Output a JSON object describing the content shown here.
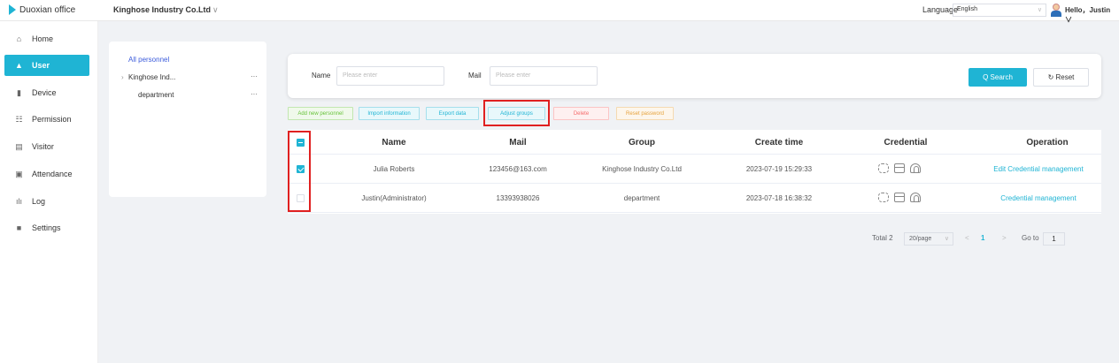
{
  "app": {
    "name": "Duoxian office",
    "company": "Kinghose Industry Co.Ltd",
    "company_chevron": "∨"
  },
  "header": {
    "language_label": "Language",
    "language_value": "English",
    "select_chevron": "∨",
    "greeting": "Hello，Justin ∨"
  },
  "sidebar": {
    "items": [
      {
        "label": "Home",
        "icon": "home-icon",
        "glyph": "⌂"
      },
      {
        "label": "User",
        "icon": "user-icon",
        "glyph": "👤"
      },
      {
        "label": "Device",
        "icon": "device-icon",
        "glyph": "▮"
      },
      {
        "label": "Permission",
        "icon": "permission-icon",
        "glyph": "☷"
      },
      {
        "label": "Visitor",
        "icon": "visitor-icon",
        "glyph": "▤"
      },
      {
        "label": "Attendance",
        "icon": "attendance-icon",
        "glyph": "▣"
      },
      {
        "label": "Log",
        "icon": "log-icon",
        "glyph": "ılı"
      },
      {
        "label": "Settings",
        "icon": "settings-icon",
        "glyph": "■"
      }
    ],
    "active": "User"
  },
  "tree": {
    "all": "All personnel",
    "nodes": [
      {
        "label": "Kinghose Ind...",
        "prefix": "›",
        "dots": "···"
      },
      {
        "label": "department",
        "dots": "···"
      }
    ]
  },
  "search": {
    "name_label": "Name",
    "name_placeholder": "Please enter",
    "mail_label": "Mail",
    "mail_placeholder": "Please enter",
    "search_button": "Q Search",
    "reset_button": "↻ Reset"
  },
  "actions": {
    "add": "Add new personnel",
    "import": "Import information",
    "export": "Export data",
    "adjust": "Adjust groups",
    "delete": "Delete",
    "reset_password": "Reset password"
  },
  "table": {
    "columns": [
      "Name",
      "Mail",
      "Group",
      "Create time",
      "Credential",
      "Operation"
    ],
    "rows": [
      {
        "name": "Julia Roberts",
        "mail": "123456@163.com",
        "group": "Kinghose Industry Co.Ltd",
        "time": "2023-07-19 15:29:33",
        "operation": "Edit  Credential management",
        "checked": true
      },
      {
        "name": "Justin(Administrator)",
        "mail": "13393938026",
        "group": "department",
        "time": "2023-07-18 16:38:32",
        "operation": "Credential management",
        "checked": false
      }
    ]
  },
  "pagination": {
    "total": "Total 2",
    "page_size": "20/page",
    "prev": "<",
    "current": "1",
    "next": ">",
    "goto_label": "Go to",
    "goto_value": "1"
  },
  "colors": {
    "accent": "#1fb4d4",
    "highlight": "#e02020"
  }
}
